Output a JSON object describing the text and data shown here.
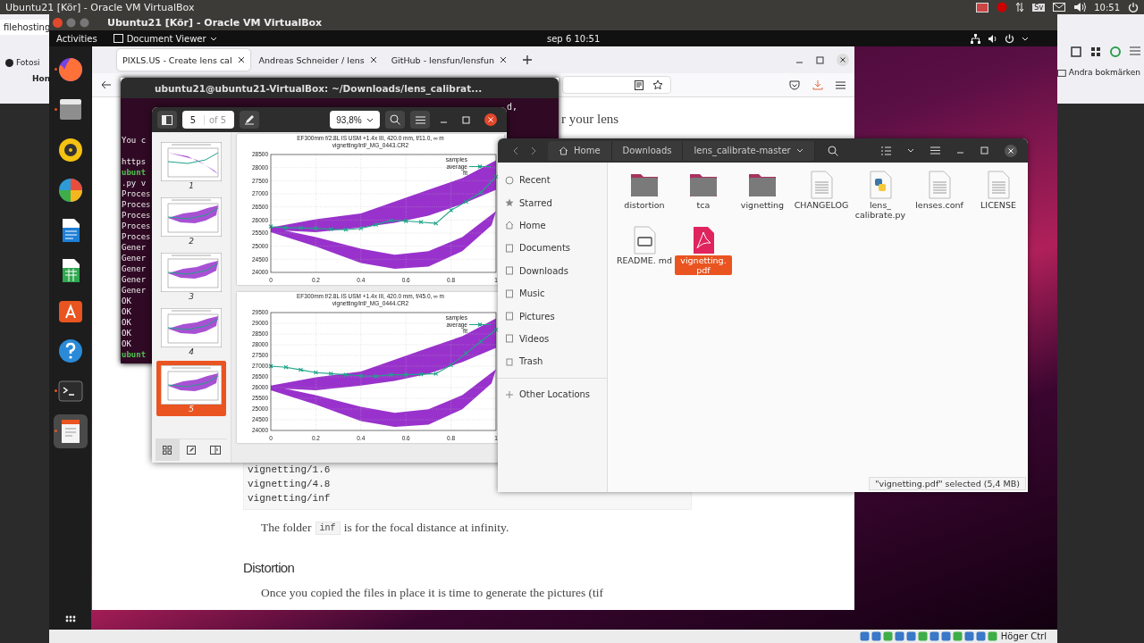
{
  "host_bar": {
    "title": "Ubuntu21 [Kör] - Oracle VM VirtualBox",
    "keyboard": "Sv",
    "time": "10:51"
  },
  "host_browser": {
    "tab": "filehosting",
    "bookmark": "Fotosi",
    "nav": "Hon",
    "bookmarks_folder": "Andra bokmärken"
  },
  "vm_window": {
    "title": "Ubuntu21 [Kör] - Oracle VM VirtualBox",
    "host_key": "Höger Ctrl"
  },
  "gnome_bar": {
    "activities": "Activities",
    "app_menu": "Document Viewer",
    "clock": "sep 6  10:51"
  },
  "dock": {
    "items": [
      {
        "kind": "firefox",
        "running": true,
        "selected": false
      },
      {
        "kind": "files",
        "running": true,
        "selected": false
      },
      {
        "kind": "music",
        "running": false,
        "selected": false
      },
      {
        "kind": "photos",
        "running": false,
        "selected": false
      },
      {
        "kind": "writer",
        "running": false,
        "selected": false
      },
      {
        "kind": "calc",
        "running": false,
        "selected": false
      },
      {
        "kind": "store",
        "running": false,
        "selected": false
      },
      {
        "kind": "help",
        "running": false,
        "selected": false
      },
      {
        "kind": "terminal",
        "running": true,
        "selected": false
      },
      {
        "kind": "viewer",
        "running": true,
        "selected": true
      }
    ]
  },
  "firefox": {
    "tabs": [
      {
        "label": "PIXLS.US - Create lens cal",
        "selected": true
      },
      {
        "label": "Andreas Schneider / lens",
        "selected": false
      },
      {
        "label": "GitHub - lensfun/lensfun",
        "selected": false
      }
    ],
    "intro_fragment": "r your lens",
    "code_lines": [
      "vignetting/1.6",
      "vignetting/4.8",
      "vignetting/inf"
    ],
    "paragraph": {
      "before": "The folder",
      "code": "inf",
      "after": "is for the focal distance at infinity."
    },
    "heading": "Distortion",
    "paragraph_2": "Once you copied the files in place it is time to generate the pictures (tif"
  },
  "terminal": {
    "title": "ubuntu21@ubuntu21-VirtualBox: ~/Downloads/lens_calibrat...",
    "fragment": "d,",
    "lines": [
      {
        "text": "You c",
        "kind": "output"
      },
      {
        "text": "https",
        "kind": "output"
      },
      {
        "text": "ubunt",
        "kind": "prompt"
      },
      {
        "text": ".py v",
        "kind": "output"
      },
      {
        "text": "Proces",
        "kind": "output"
      },
      {
        "text": "Proces",
        "kind": "output"
      },
      {
        "text": "Proces",
        "kind": "output"
      },
      {
        "text": "Proces",
        "kind": "output"
      },
      {
        "text": "Proces",
        "kind": "output"
      },
      {
        "text": "Gener",
        "kind": "output"
      },
      {
        "text": "Gener",
        "kind": "output"
      },
      {
        "text": "Gener",
        "kind": "output"
      },
      {
        "text": "Gener",
        "kind": "output"
      },
      {
        "text": "Gener",
        "kind": "output"
      },
      {
        "text": "OK",
        "kind": "output"
      },
      {
        "text": "OK",
        "kind": "output"
      },
      {
        "text": "OK",
        "kind": "output"
      },
      {
        "text": "OK",
        "kind": "output"
      },
      {
        "text": "OK",
        "kind": "output"
      },
      {
        "text": "ubunt",
        "kind": "prompt"
      }
    ]
  },
  "doc_viewer": {
    "page": "5",
    "page_count": "of 5",
    "zoom": "93,8%",
    "thumbnails": [
      {
        "label": "1",
        "selected": false
      },
      {
        "label": "2",
        "selected": false
      },
      {
        "label": "3",
        "selected": false
      },
      {
        "label": "4",
        "selected": false
      },
      {
        "label": "5",
        "selected": true
      }
    ],
    "pages": [
      {
        "title": "EF300mm f/2.8L IS USM +1.4x III, 420.0 mm, f/11.0, ∞ m",
        "file": "vignetting/inf/_MG_0443.CR2",
        "cloud_label": "samples",
        "fit_label": "fit",
        "chart_data": {
          "type": "line",
          "grid": true,
          "legend": "upper right",
          "x": [
            0,
            0.067,
            0.133,
            0.2,
            0.267,
            0.333,
            0.4,
            0.467,
            0.533,
            0.6,
            0.667,
            0.733,
            0.8,
            0.867,
            0.933,
            1
          ],
          "series": [
            {
              "name": "average",
              "color": "#1fa38a",
              "marker": "cross",
              "values": [
                25750,
                25700,
                25700,
                25680,
                25650,
                25630,
                25680,
                25820,
                25980,
                25960,
                25920,
                25870,
                26370,
                26700,
                27050,
                27650
              ]
            }
          ],
          "xlim": [
            0,
            1
          ],
          "ylim": [
            24000,
            28500
          ],
          "xticks": [
            0,
            0.2,
            0.4,
            0.6,
            0.8,
            1
          ],
          "yticks": [
            24000,
            24500,
            25000,
            25500,
            26000,
            26500,
            27000,
            27500,
            28000,
            28500
          ]
        }
      },
      {
        "title": "EF300mm f/2.8L IS USM +1.4x III, 420.0 mm, f/45.0, ∞ m",
        "file": "vignetting/inf/_MG_0444.CR2",
        "cloud_label": "samples",
        "fit_label": "fit",
        "chart_data": {
          "type": "line",
          "grid": true,
          "legend": "upper right",
          "x": [
            0,
            0.067,
            0.133,
            0.2,
            0.267,
            0.333,
            0.4,
            0.467,
            0.533,
            0.6,
            0.667,
            0.733,
            0.8,
            0.867,
            0.933,
            1
          ],
          "series": [
            {
              "name": "average",
              "color": "#1fa38a",
              "marker": "cross",
              "values": [
                27000,
                26950,
                26830,
                26700,
                26650,
                26600,
                26550,
                26530,
                26600,
                26600,
                26620,
                26650,
                27050,
                27600,
                28150,
                28700
              ]
            }
          ],
          "xlim": [
            0,
            1
          ],
          "ylim": [
            24000,
            29500
          ],
          "xticks": [
            0,
            0.2,
            0.4,
            0.6,
            0.8,
            1
          ],
          "yticks": [
            24000,
            24500,
            25000,
            25500,
            26000,
            26500,
            27000,
            27500,
            28000,
            28500,
            29000,
            29500
          ]
        }
      }
    ]
  },
  "files": {
    "path": [
      "Home",
      "Downloads",
      "lens_calibrate-master"
    ],
    "sidebar": [
      {
        "label": "Recent",
        "kind": "recent"
      },
      {
        "label": "Starred",
        "kind": "starred"
      },
      {
        "label": "Home",
        "kind": "home"
      },
      {
        "label": "Documents",
        "kind": "documents"
      },
      {
        "label": "Downloads",
        "kind": "downloads"
      },
      {
        "label": "Music",
        "kind": "music"
      },
      {
        "label": "Pictures",
        "kind": "pictures"
      },
      {
        "label": "Videos",
        "kind": "videos"
      },
      {
        "label": "Trash",
        "kind": "trash"
      },
      {
        "label": "Other Locations",
        "kind": "other"
      }
    ],
    "items": [
      {
        "name": "distortion",
        "kind": "folder",
        "selected": false
      },
      {
        "name": "tca",
        "kind": "folder",
        "selected": false
      },
      {
        "name": "vignetting",
        "kind": "folder",
        "selected": false
      },
      {
        "name": "CHANGELOG",
        "kind": "text",
        "selected": false
      },
      {
        "name": "lens_ calibrate.py",
        "kind": "python",
        "selected": false
      },
      {
        "name": "lenses.conf",
        "kind": "text",
        "selected": false
      },
      {
        "name": "LICENSE",
        "kind": "text",
        "selected": false
      },
      {
        "name": "README. md",
        "kind": "markdown",
        "selected": false
      },
      {
        "name": "vignetting. pdf",
        "kind": "pdf",
        "selected": true
      }
    ],
    "status": "\"vignetting.pdf\" selected  (5,4 MB)"
  }
}
